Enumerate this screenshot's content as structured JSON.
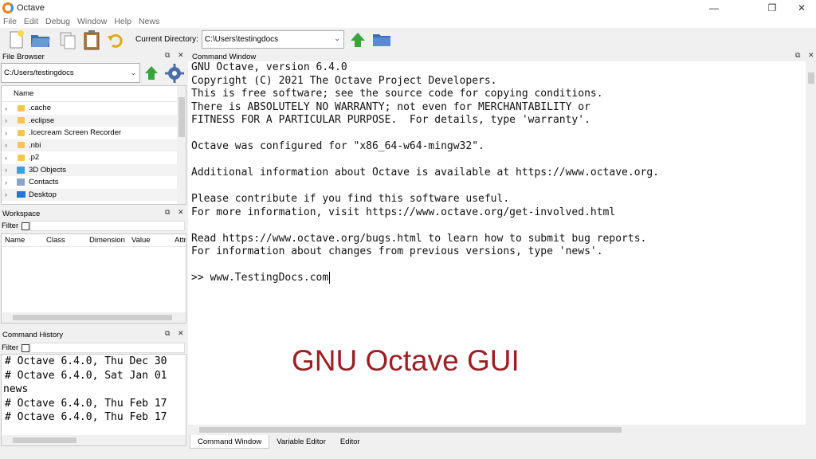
{
  "window": {
    "title": "Octave",
    "minimize": "—",
    "maximize": "❐",
    "close": "✕"
  },
  "menu": [
    "File",
    "Edit",
    "Debug",
    "Window",
    "Help",
    "News"
  ],
  "toolbar": {
    "current_directory_label": "Current Directory:",
    "current_directory_value": "C:\\Users\\testingdocs"
  },
  "file_browser": {
    "title": "File Browser",
    "path": "C:/Users/testingdocs",
    "column_name": "Name",
    "items": [
      ".cache",
      ".eclipse",
      ".Icecream Screen Recorder",
      ".nbi",
      ".p2",
      "3D Objects",
      "Contacts",
      "Desktop"
    ]
  },
  "workspace": {
    "title": "Workspace",
    "filter_label": "Filter",
    "columns": [
      "Name",
      "Class",
      "Dimension",
      "Value",
      "Attr"
    ]
  },
  "command_history": {
    "title": "Command History",
    "filter_label": "Filter",
    "entries": [
      "# Octave 6.4.0, Thu Dec 30",
      "# Octave 6.4.0, Sat Jan 01",
      "news",
      "# Octave 6.4.0, Thu Feb 17",
      "# Octave 6.4.0, Thu Feb 17"
    ]
  },
  "command_window": {
    "title": "Command Window",
    "lines": [
      "GNU Octave, version 6.4.0",
      "Copyright (C) 2021 The Octave Project Developers.",
      "This is free software; see the source code for copying conditions.",
      "There is ABSOLUTELY NO WARRANTY; not even for MERCHANTABILITY or",
      "FITNESS FOR A PARTICULAR PURPOSE.  For details, type 'warranty'.",
      "",
      "Octave was configured for \"x86_64-w64-mingw32\".",
      "",
      "Additional information about Octave is available at https://www.octave.org.",
      "",
      "Please contribute if you find this software useful.",
      "For more information, visit https://www.octave.org/get-involved.html",
      "",
      "Read https://www.octave.org/bugs.html to learn how to submit bug reports.",
      "For information about changes from previous versions, type 'news'.",
      "",
      ">> www.TestingDocs.com"
    ]
  },
  "overlay_caption": "GNU Octave GUI",
  "bottom_tabs": [
    "Command Window",
    "Variable Editor",
    "Editor"
  ],
  "dock_undock": "⧉",
  "dock_close": "✕"
}
